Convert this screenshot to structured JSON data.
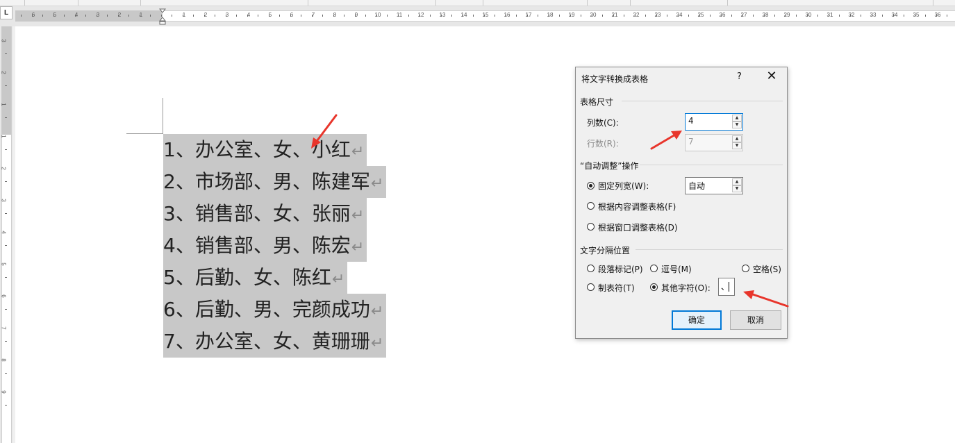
{
  "ruler": {
    "tab_selector": "L",
    "left_labels": [
      "6",
      "5",
      "4",
      "3",
      "2",
      "1"
    ],
    "right_labels": [
      "1",
      "2",
      "3",
      "4",
      "5",
      "6",
      "7",
      "8",
      "9",
      "10",
      "11",
      "12",
      "13",
      "14",
      "15",
      "16",
      "17",
      "18",
      "19",
      "20",
      "21",
      "22",
      "23",
      "24",
      "25",
      "26",
      "27",
      "28",
      "29",
      "30",
      "31",
      "32",
      "33",
      "34",
      "35",
      "36"
    ],
    "vertical_labels": [
      "3",
      "2",
      "1",
      "1",
      "2",
      "3",
      "4",
      "5",
      "6",
      "7",
      "8",
      "9"
    ]
  },
  "document": {
    "paragraph_mark": "↵",
    "lines": [
      "1、办公室、女、小红",
      "2、市场部、男、陈建军",
      "3、销售部、女、张丽",
      "4、销售部、男、陈宏",
      "5、后勤、女、陈红",
      "6、后勤、男、完颜成功",
      "7、办公室、女、黄珊珊"
    ]
  },
  "dialog": {
    "title": "将文字转换成表格",
    "help": "?",
    "close": "✕",
    "table_size": {
      "section": "表格尺寸",
      "columns_label": "列数(C):",
      "columns_value": "4",
      "rows_label": "行数(R):",
      "rows_value": "7"
    },
    "autofit": {
      "section": "“自动调整”操作",
      "fixed_label": "固定列宽(W):",
      "fixed_value": "自动",
      "content_label": "根据内容调整表格(F)",
      "window_label": "根据窗口调整表格(D)"
    },
    "separator": {
      "section": "文字分隔位置",
      "paragraph_label": "段落标记(P)",
      "comma_label": "逗号(M)",
      "space_label": "空格(S)",
      "tab_label": "制表符(T)",
      "other_label": "其他字符(O):",
      "other_value": "、"
    },
    "ok": "确定",
    "cancel": "取消"
  },
  "colors": {
    "selection": "#c8c8c8",
    "accent": "#0078d7",
    "annotation_arrow": "#e8352b"
  }
}
